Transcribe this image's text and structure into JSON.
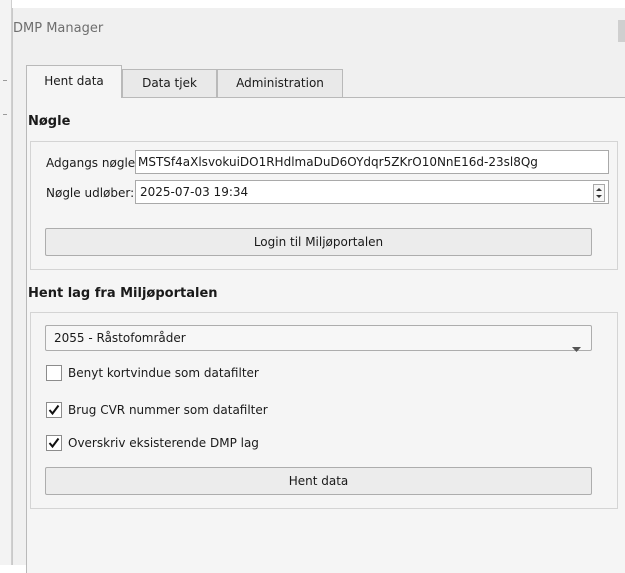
{
  "window": {
    "title": "DMP Manager"
  },
  "tabs": [
    {
      "label": "Hent data",
      "active": true
    },
    {
      "label": "Data tjek",
      "active": false
    },
    {
      "label": "Administration",
      "active": false
    }
  ],
  "key_section": {
    "title": "Nøgle",
    "access_key_label": "Adgangs nøgle",
    "access_key_value": "MSTSf4aXlsvokuiDO1RHdlmaDuD6OYdqr5ZKrO10NnE16d-23sl8Qg",
    "expiry_label": "Nøgle udløber:",
    "expiry_value": "2025-07-03 19:34",
    "login_button": "Login til Miljøportalen"
  },
  "fetch_section": {
    "title": "Hent lag fra Miljøportalen",
    "layer_select": {
      "value": "2055 - Råstofområder"
    },
    "options": [
      {
        "label": "Benyt kortvindue som datafilter",
        "checked": false
      },
      {
        "label": "Brug CVR nummer som datafilter",
        "checked": true
      },
      {
        "label": "Overskriv eksisterende DMP lag",
        "checked": true
      }
    ],
    "fetch_button": "Hent data"
  },
  "icons": {
    "spinner": "spinner-arrows-icon",
    "dropdown": "chevron-down-icon",
    "checkmark": "checkmark-icon"
  }
}
